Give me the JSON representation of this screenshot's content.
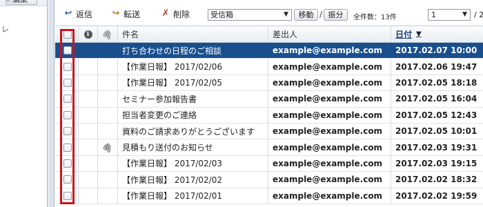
{
  "left_pane": {
    "top_label": "編集",
    "side_glyph": "レ"
  },
  "toolbar": {
    "reply_label": "返信",
    "forward_label": "転送",
    "delete_label": "削除",
    "folder_value": "受信箱",
    "move_label": "移動",
    "separator": "/",
    "sort_label": "振分",
    "total_label": "全件数：13件",
    "page_value": "1",
    "page_total": "/ 2"
  },
  "columns": {
    "subject": "件名",
    "sender": "差出人",
    "date": "日付",
    "sort_indicator": "▼"
  },
  "messages": [
    {
      "subject": "打ち合わせの日程のご相談",
      "sender": "example@example.com",
      "date": "2017.02.07 10:00",
      "attachment": false,
      "selected": true
    },
    {
      "subject": "【作業日報】 2017/02/06",
      "sender": "example@example.com",
      "date": "2017.02.06 19:47",
      "attachment": false,
      "selected": false
    },
    {
      "subject": "【作業日報】 2017/02/05",
      "sender": "example@example.com",
      "date": "2017.02.05 18:18",
      "attachment": false,
      "selected": false
    },
    {
      "subject": "セミナー参加報告書",
      "sender": "example@example.com",
      "date": "2017.02.05 16:04",
      "attachment": false,
      "selected": false
    },
    {
      "subject": "担当者変更のご連絡",
      "sender": "example@example.com",
      "date": "2017.02.05 12:43",
      "attachment": false,
      "selected": false
    },
    {
      "subject": "資料のご請求ありがとうございます",
      "sender": "example@example.com",
      "date": "2017.02.05 10:01",
      "attachment": false,
      "selected": false
    },
    {
      "subject": "見積もり送付のお知らせ",
      "sender": "example@example.com",
      "date": "2017.02.03 19:31",
      "attachment": true,
      "selected": false
    },
    {
      "subject": "【作業日報】 2017/02/03",
      "sender": "example@example.com",
      "date": "2017.02.03 19:15",
      "attachment": false,
      "selected": false
    },
    {
      "subject": "【作業日報】 2017/02/02",
      "sender": "example@example.com",
      "date": "2017.02.02 18:32",
      "attachment": false,
      "selected": false
    },
    {
      "subject": "【作業日報】 2017/02/01",
      "sender": "example@example.com",
      "date": "2017.02.02 19:59",
      "attachment": false,
      "selected": false
    }
  ],
  "colors": {
    "selected_row": "#1a4f8e",
    "highlight_box": "#d0121a"
  }
}
